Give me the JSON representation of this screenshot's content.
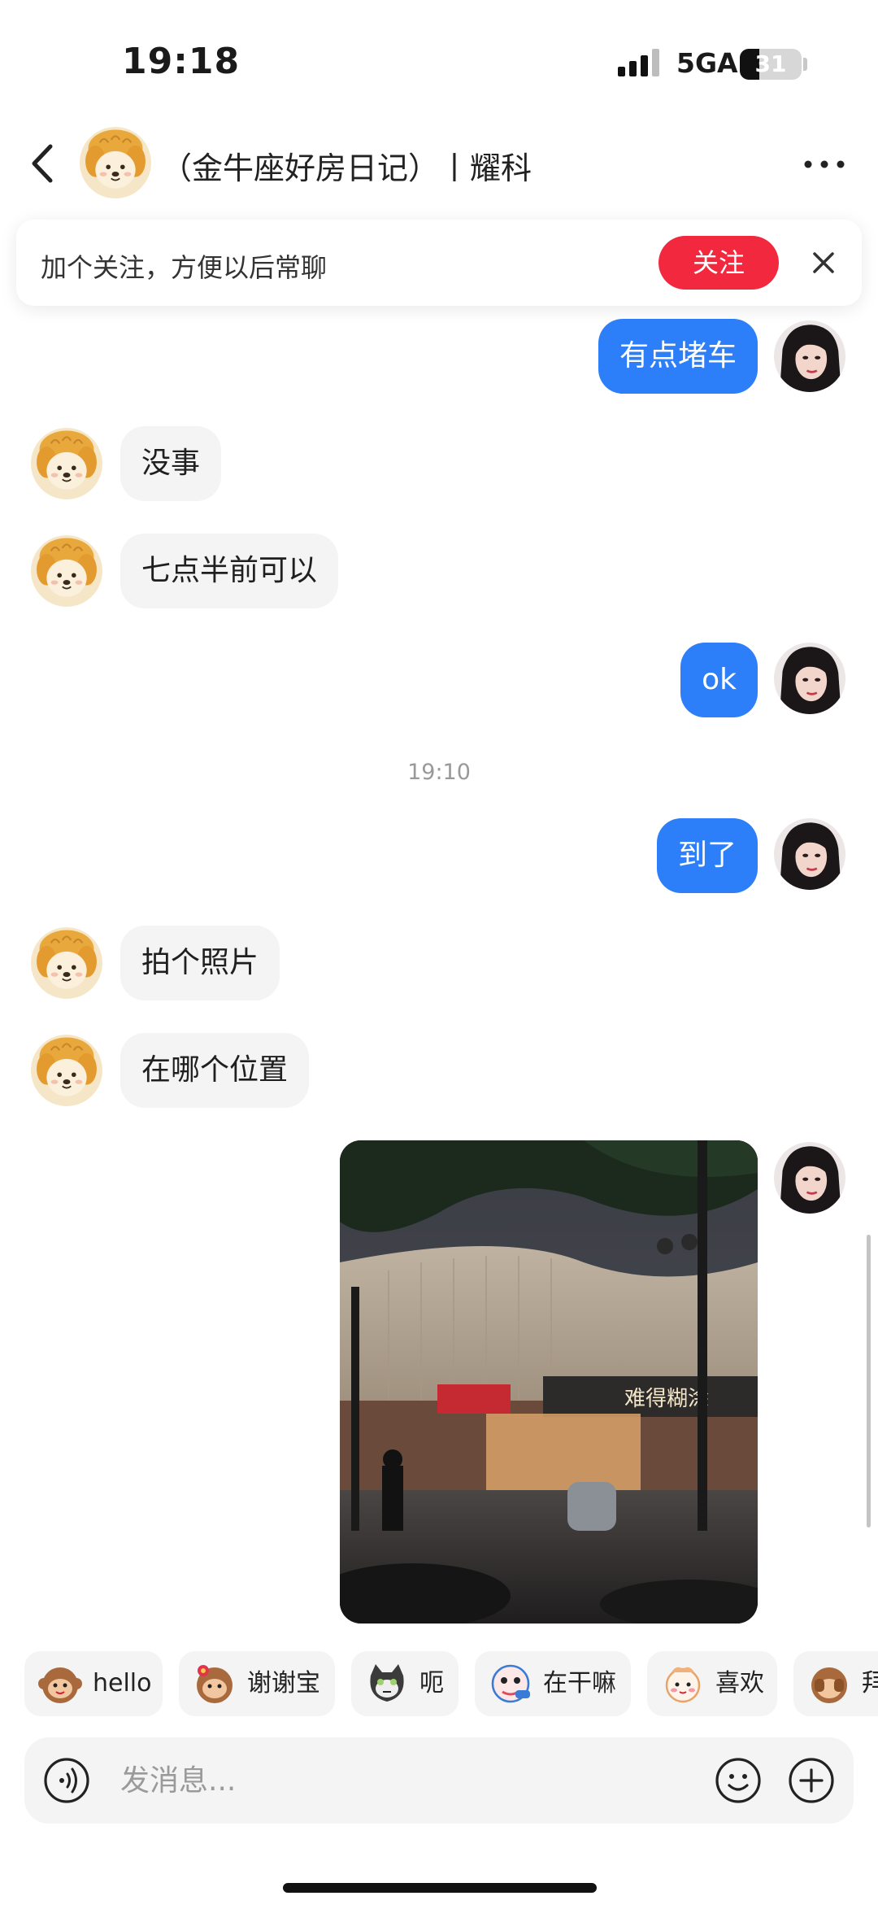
{
  "status_bar": {
    "time": "19:18",
    "network": "5GA",
    "battery_level": "31",
    "battery_fraction": 0.31
  },
  "header": {
    "title": "（金牛座好房日记）丨耀科",
    "back_icon": "chevron-left-icon",
    "more_icon": "more-dots-icon"
  },
  "follow_banner": {
    "text": "加个关注，方便以后常聊",
    "follow_label": "关注",
    "close_icon": "close-icon",
    "accent": "#f2283f"
  },
  "messages": [
    {
      "side": "out",
      "text": "有点堵车"
    },
    {
      "side": "in",
      "text": "没事"
    },
    {
      "side": "in",
      "text": "七点半前可以"
    },
    {
      "side": "out",
      "text": "ok"
    },
    {
      "side": "divider",
      "text": "19:10"
    },
    {
      "side": "out",
      "text": "到了"
    },
    {
      "side": "in",
      "text": "拍个照片"
    },
    {
      "side": "in",
      "text": "在哪个位置"
    },
    {
      "side": "out",
      "type": "image",
      "image_signage": "难得糊涂"
    }
  ],
  "quick_replies": [
    {
      "label": "hello",
      "icon": "monkey-hello-icon"
    },
    {
      "label": "谢谢宝",
      "icon": "monkey-flower-icon"
    },
    {
      "label": "呃",
      "icon": "cat-face-icon"
    },
    {
      "label": "在干嘛",
      "icon": "peeking-face-icon"
    },
    {
      "label": "喜欢",
      "icon": "blushing-face-icon"
    },
    {
      "label": "拜",
      "icon": "monkey-bye-icon"
    }
  ],
  "input": {
    "placeholder": "发消息...",
    "voice_icon": "voice-icon",
    "emoji_icon": "smiley-icon",
    "plus_icon": "plus-icon"
  },
  "colors": {
    "outgoing_bubble": "#2d7ff9",
    "incoming_bubble": "#f4f4f4",
    "accent_red": "#f2283f"
  }
}
